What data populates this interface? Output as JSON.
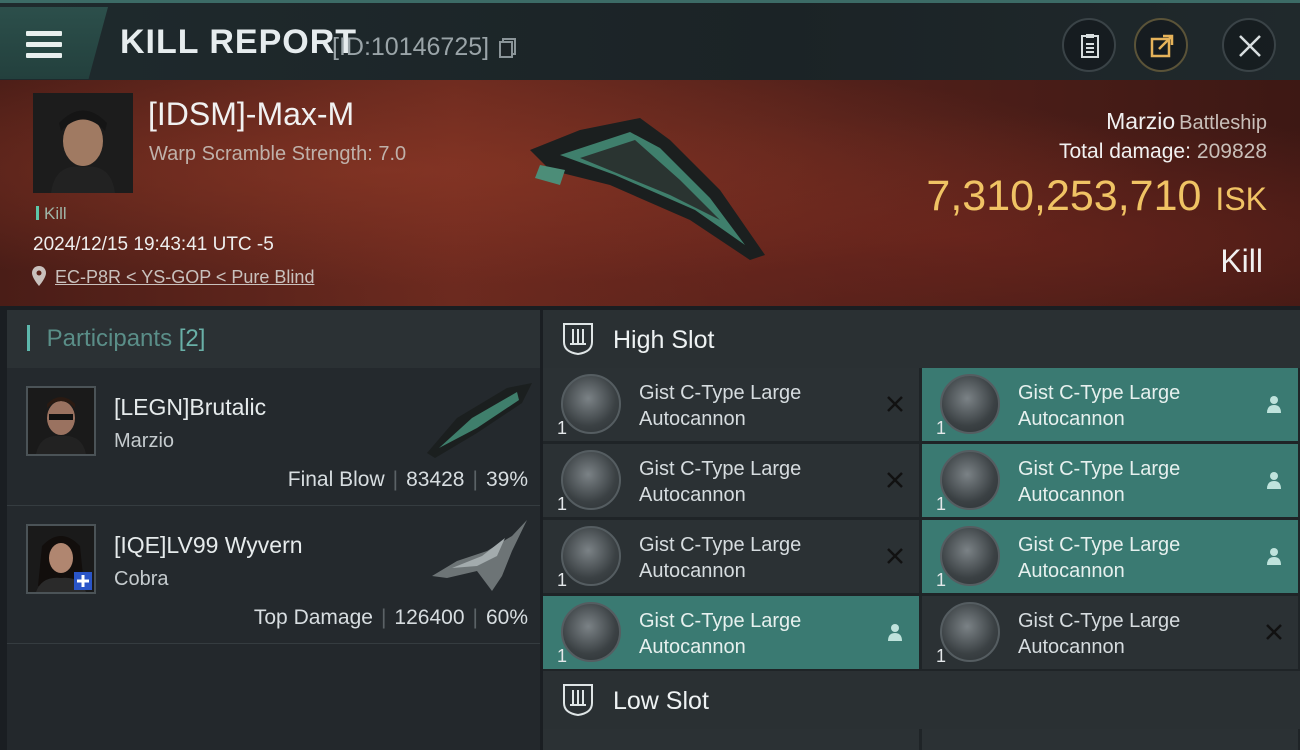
{
  "header": {
    "title": "KILL REPORT",
    "report_id": "[ID:10146725]"
  },
  "victim": {
    "name": "[IDSM]-Max-M",
    "scramble": "Warp Scramble Strength: 7.0",
    "tag": "Kill",
    "datetime": "2024/12/15 19:43:41 UTC -5",
    "location": "EC-P8R < YS-GOP < Pure Blind",
    "ship_name": "Marzio",
    "ship_class": "Battleship",
    "total_damage_label": "Total damage:",
    "total_damage": "209828",
    "isk_value": "7,310,253,710",
    "isk_unit": "ISK",
    "result": "Kill"
  },
  "participants": {
    "label": "Participants",
    "count": "[2]",
    "list": [
      {
        "name": "[LEGN]Brutalic",
        "ship": "Marzio",
        "role": "Final Blow",
        "damage": "83428",
        "percent": "39%"
      },
      {
        "name": "[IQE]LV99 Wyvern",
        "ship": "Cobra",
        "role": "Top Damage",
        "damage": "126400",
        "percent": "60%"
      }
    ]
  },
  "slots": {
    "high_title": "High Slot",
    "low_title": "Low Slot",
    "high_items": [
      {
        "name": "Gist C-Type Large Autocannon",
        "qty": "1",
        "status": "destroyed"
      },
      {
        "name": "Gist C-Type Large Autocannon",
        "qty": "1",
        "status": "dropped"
      },
      {
        "name": "Gist C-Type Large Autocannon",
        "qty": "1",
        "status": "destroyed"
      },
      {
        "name": "Gist C-Type Large Autocannon",
        "qty": "1",
        "status": "dropped"
      },
      {
        "name": "Gist C-Type Large Autocannon",
        "qty": "1",
        "status": "destroyed"
      },
      {
        "name": "Gist C-Type Large Autocannon",
        "qty": "1",
        "status": "dropped"
      },
      {
        "name": "Gist C-Type Large Autocannon",
        "qty": "1",
        "status": "dropped"
      },
      {
        "name": "Gist C-Type Large Autocannon",
        "qty": "1",
        "status": "destroyed"
      }
    ]
  },
  "colors": {
    "accent": "#3a7a72",
    "isk": "#f0c364",
    "banner": "#6b2a1f"
  },
  "icons": [
    "menu-icon",
    "copy-icon",
    "clipboard-icon",
    "share-icon",
    "close-icon",
    "location-pin-icon",
    "high-slot-icon",
    "low-slot-icon",
    "person-icon",
    "x-mark-icon"
  ]
}
